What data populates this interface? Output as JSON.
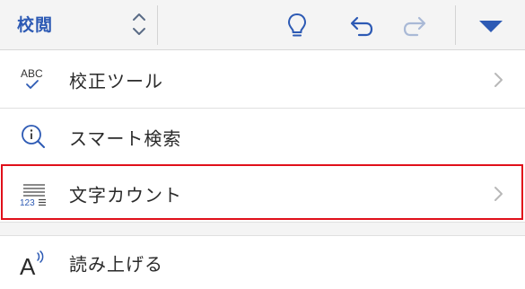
{
  "toolbar": {
    "tab_label": "校閲",
    "icons": [
      "up-down-chevron-icon",
      "lightbulb-icon",
      "undo-icon",
      "redo-icon",
      "dropdown-triangle-icon"
    ]
  },
  "menu": {
    "items": [
      {
        "label": "校正ツール",
        "icon": "abc-check-icon",
        "icon_text": "ABC",
        "has_chevron": true
      },
      {
        "label": "スマート検索",
        "icon": "smart-lookup-icon",
        "has_chevron": false
      },
      {
        "label": "文字カウント",
        "icon": "word-count-icon",
        "icon_text": "123",
        "has_chevron": true,
        "highlighted": true
      },
      {
        "label": "読み上げる",
        "icon": "read-aloud-icon",
        "icon_text": "A",
        "has_chevron": false
      }
    ]
  },
  "colors": {
    "accent": "#2d5ab4",
    "highlight_border": "#e0101a",
    "toolbar_bg": "#f4f4f4"
  }
}
